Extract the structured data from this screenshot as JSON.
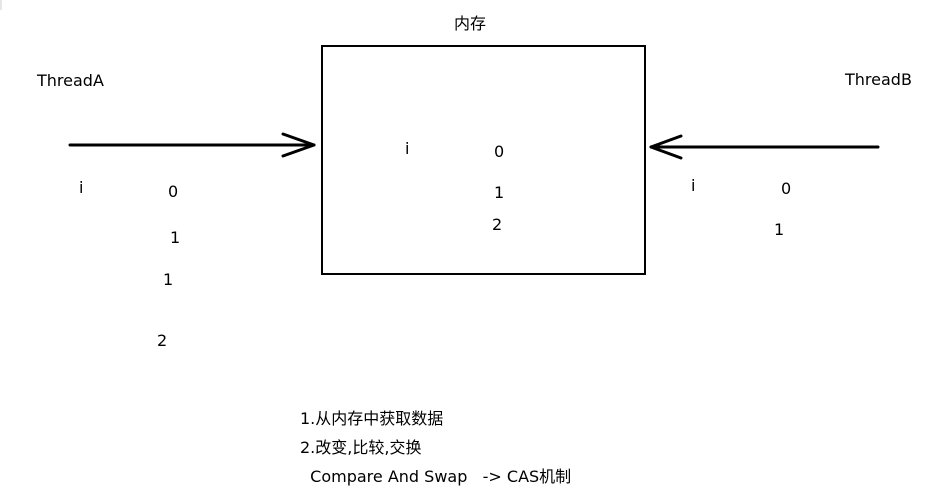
{
  "memory": {
    "title": "内存",
    "var_label": "i",
    "values": [
      "0",
      "1",
      "2"
    ]
  },
  "thread_a": {
    "title": "ThreadA",
    "var_label": "i",
    "values": [
      "0",
      "1",
      "1",
      "2"
    ]
  },
  "thread_b": {
    "title": "ThreadB",
    "var_label": "i",
    "values": [
      "0",
      "1"
    ]
  },
  "notes": {
    "line1": "1.从内存中获取数据",
    "line2": "2.改变,比较,交换",
    "line3": "  Compare And Swap   -> CAS机制"
  },
  "colors": {
    "stroke": "#000000",
    "background": "#ffffff"
  }
}
